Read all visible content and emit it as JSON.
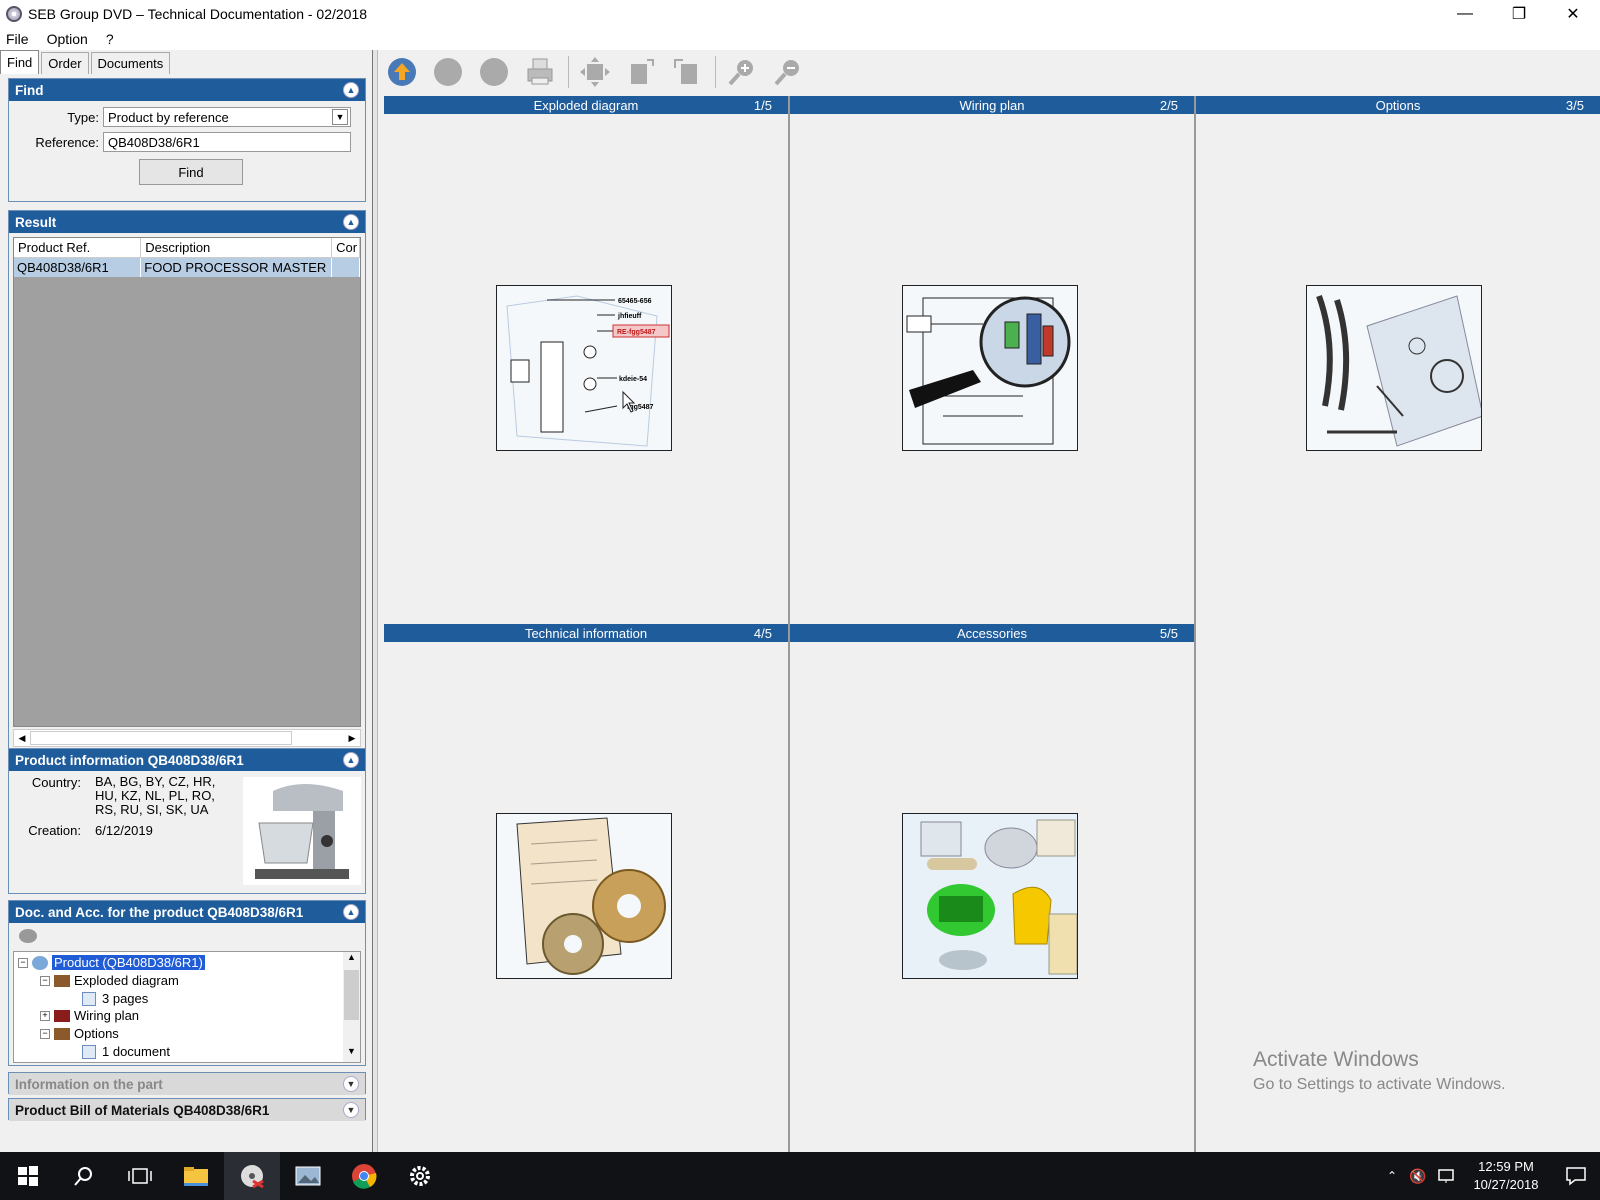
{
  "window": {
    "title": "SEB Group DVD – Technical Documentation - 02/2018"
  },
  "menu": [
    "File",
    "Option",
    "?"
  ],
  "tabs": [
    "Find",
    "Order",
    "Documents"
  ],
  "find": {
    "header": "Find",
    "type_label": "Type:",
    "type_value": "Product by reference",
    "reference_label": "Reference:",
    "reference_value": "QB408D38/6R1",
    "find_button": "Find"
  },
  "result": {
    "header": "Result",
    "columns": [
      "Product Ref.",
      "Description",
      "Cor"
    ],
    "rows": [
      [
        "QB408D38/6R1",
        "FOOD PROCESSOR MASTER",
        ""
      ]
    ]
  },
  "product_info": {
    "header": "Product information QB408D38/6R1",
    "country_label": "Country:",
    "country_line1": "BA, BG, BY, CZ, HR,",
    "country_line2": "HU, KZ, NL, PL, RO,",
    "country_line3": "RS, RU, SI, SK, UA",
    "creation_label": "Creation:",
    "creation_value": "6/12/2019"
  },
  "doc_acc": {
    "header": "Doc. and Acc. for the product QB408D38/6R1",
    "tree": {
      "root": "Product (QB408D38/6R1)",
      "exploded": "Exploded diagram",
      "pages": "3 pages",
      "wiring": "Wiring plan",
      "options": "Options",
      "document": "1 document"
    }
  },
  "info_part": {
    "header": "Information on the part"
  },
  "bom": {
    "header": "Product Bill of Materials QB408D38/6R1"
  },
  "cells": [
    {
      "title": "Exploded diagram",
      "num": "1/5"
    },
    {
      "title": "Wiring plan",
      "num": "2/5"
    },
    {
      "title": "Options",
      "num": "3/5"
    },
    {
      "title": "Technical information",
      "num": "4/5"
    },
    {
      "title": "Accessories",
      "num": "5/5"
    }
  ],
  "diagram_labels": [
    "65465-656",
    "jhfieuff",
    "RE-fgg5487",
    "kdeie-54",
    "fgg5487"
  ],
  "watermark": {
    "line1": "Activate Windows",
    "line2": "Go to Settings to activate Windows."
  },
  "clock": {
    "time": "12:59 PM",
    "date": "10/27/2018"
  },
  "colors": {
    "header_blue": "#1f5c9c",
    "selection": "#b7cde4"
  }
}
